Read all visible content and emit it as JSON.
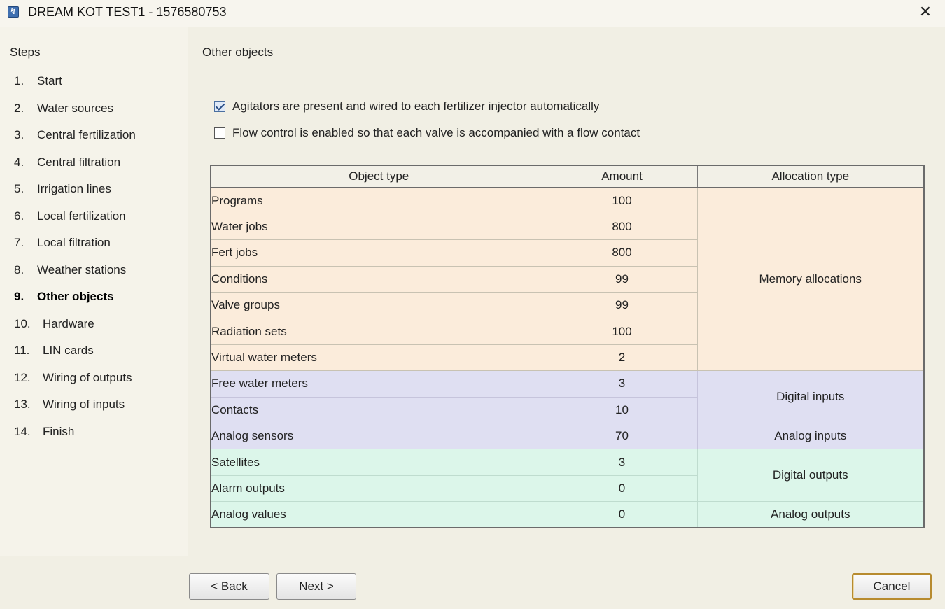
{
  "window": {
    "title": "DREAM KOT TEST1 - 1576580753",
    "close_glyph": "✕"
  },
  "sidebar": {
    "header": "Steps",
    "steps": [
      {
        "num": "1.",
        "label": "Start"
      },
      {
        "num": "2.",
        "label": "Water sources"
      },
      {
        "num": "3.",
        "label": "Central fertilization"
      },
      {
        "num": "4.",
        "label": "Central filtration"
      },
      {
        "num": "5.",
        "label": "Irrigation lines"
      },
      {
        "num": "6.",
        "label": "Local fertilization"
      },
      {
        "num": "7.",
        "label": "Local filtration"
      },
      {
        "num": "8.",
        "label": "Weather stations"
      },
      {
        "num": "9.",
        "label": "Other objects"
      },
      {
        "num": "10.",
        "label": "Hardware"
      },
      {
        "num": "11.",
        "label": "LIN cards"
      },
      {
        "num": "12.",
        "label": "Wiring of outputs"
      },
      {
        "num": "13.",
        "label": "Wiring of inputs"
      },
      {
        "num": "14.",
        "label": "Finish"
      }
    ],
    "active_step": 9
  },
  "main": {
    "section_title": "Other objects",
    "options": [
      {
        "label": "Agitators are present and wired to each fertilizer injector automatically",
        "checked": true
      },
      {
        "label": "Flow control is enabled so that each valve is accompanied with a flow contact",
        "checked": false
      }
    ],
    "table": {
      "headers": [
        "Object type",
        "Amount",
        "Allocation type"
      ],
      "rows": [
        {
          "object": "Programs",
          "amount": "100"
        },
        {
          "object": "Water jobs",
          "amount": "800"
        },
        {
          "object": "Fert jobs",
          "amount": "800"
        },
        {
          "object": "Conditions",
          "amount": "99"
        },
        {
          "object": "Valve groups",
          "amount": "99"
        },
        {
          "object": "Radiation sets",
          "amount": "100"
        },
        {
          "object": "Virtual water meters",
          "amount": "2"
        },
        {
          "object": "Free water meters",
          "amount": "3"
        },
        {
          "object": "Contacts",
          "amount": "10"
        },
        {
          "object": "Analog sensors",
          "amount": "70"
        },
        {
          "object": "Satellites",
          "amount": "3"
        },
        {
          "object": "Alarm outputs",
          "amount": "0"
        },
        {
          "object": "Analog values",
          "amount": "0"
        }
      ],
      "allocations": {
        "memory": "Memory allocations",
        "digital_inputs": "Digital inputs",
        "analog_inputs": "Analog inputs",
        "digital_outputs": "Digital outputs",
        "analog_outputs": "Analog outputs"
      }
    }
  },
  "footer": {
    "back_prefix": "< ",
    "back_mnemonic": "B",
    "back_rest": "ack",
    "next_mnemonic": "N",
    "next_rest": "ext >",
    "cancel": "Cancel"
  },
  "colors": {
    "memory_rows": "#fbecdb",
    "input_rows": "#dfdff2",
    "output_rows": "#dcf6ea",
    "default_button_border": "#b78b2f"
  }
}
